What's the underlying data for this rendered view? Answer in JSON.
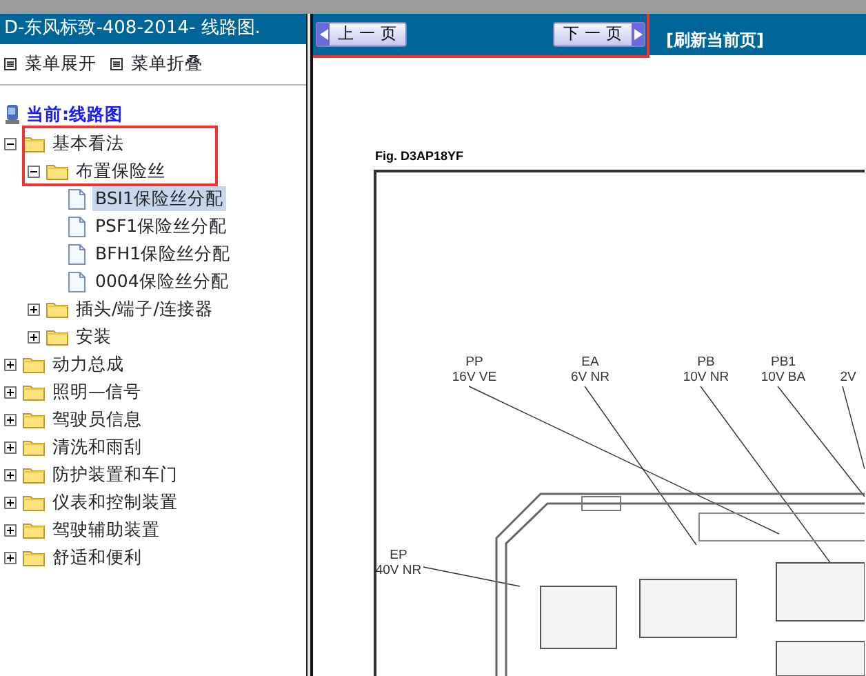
{
  "sidebar": {
    "title": "D-东风标致-408-2014- 线路图.",
    "toolbar": [
      "菜单展开",
      "菜单折叠"
    ],
    "current": "当前:线路图",
    "tree": [
      {
        "label": "基本看法",
        "expanded": true,
        "highlighted": true,
        "children": [
          {
            "label": "布置保险丝",
            "expanded": true,
            "highlighted": true,
            "children": [
              {
                "label": "BSI1保险丝分配",
                "selected": true
              },
              {
                "label": "PSF1保险丝分配",
                "selected": false
              },
              {
                "label": "BFH1保险丝分配",
                "selected": false
              },
              {
                "label": "0004保险丝分配",
                "selected": false
              }
            ]
          },
          {
            "label": "插头/端子/连接器",
            "expanded": false,
            "highlighted": false
          },
          {
            "label": "安装",
            "expanded": false,
            "highlighted": false
          }
        ]
      },
      {
        "label": "动力总成",
        "expanded": false,
        "highlighted": false
      },
      {
        "label": "照明—信号",
        "expanded": false,
        "highlighted": false
      },
      {
        "label": "驾驶员信息",
        "expanded": false,
        "highlighted": false
      },
      {
        "label": "清洗和雨刮",
        "expanded": false,
        "highlighted": false
      },
      {
        "label": "防护装置和车门",
        "expanded": false,
        "highlighted": false
      },
      {
        "label": "仪表和控制装置",
        "expanded": false,
        "highlighted": false
      },
      {
        "label": "驾驶辅助装置",
        "expanded": false,
        "highlighted": false
      },
      {
        "label": "舒适和便利",
        "expanded": false,
        "highlighted": false
      }
    ]
  },
  "navbar": {
    "highlighted": true,
    "prev": "上 一 页",
    "next": "下 一 页",
    "refresh": "[刷新当前页]"
  },
  "figure": {
    "caption": "Fig. D3AP18YF",
    "labels": [
      {
        "name": "PP",
        "spec": "16V VE"
      },
      {
        "name": "EA",
        "spec": "6V NR"
      },
      {
        "name": "PB",
        "spec": "10V NR"
      },
      {
        "name": "PB1",
        "spec": "10V BA"
      },
      {
        "spec": "2V"
      },
      {
        "name": "EP",
        "spec": "40V NR"
      }
    ]
  }
}
